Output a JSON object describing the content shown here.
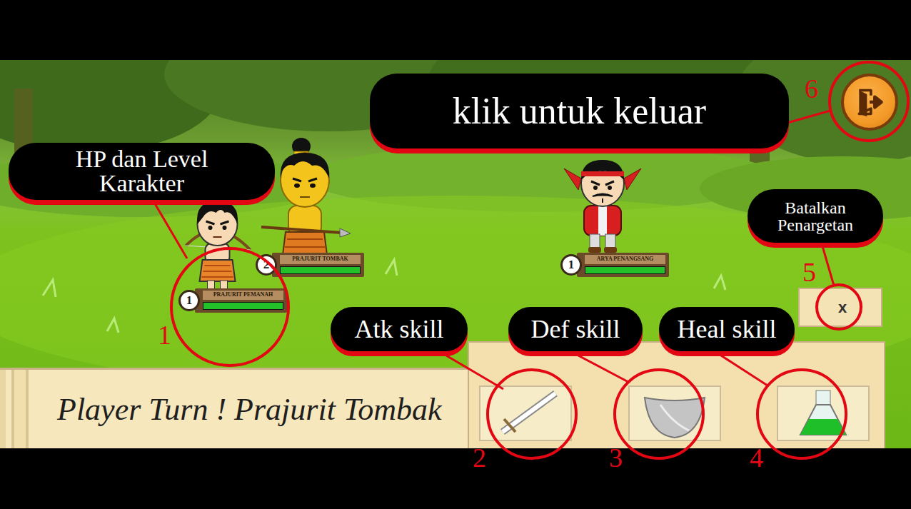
{
  "characters": [
    {
      "name": "PRAJURIT TOMBAK",
      "level": "2",
      "hp": 1,
      "kind": "spearman"
    },
    {
      "name": "PRAJURIT PEMANAH",
      "level": "1",
      "hp": 1,
      "kind": "archer"
    },
    {
      "name": "ARYA PENANGSANG",
      "level": "1",
      "hp": 1,
      "kind": "enemy"
    }
  ],
  "turn_text": "Player Turn ! Prajurit Tombak",
  "skills": [
    {
      "kind": "attack"
    },
    {
      "kind": "defense"
    },
    {
      "kind": "heal"
    }
  ],
  "cancel_label": "x",
  "annotations": [
    {
      "number": "1",
      "label": "HP dan Level Karakter"
    },
    {
      "number": "2",
      "label": "Atk skill"
    },
    {
      "number": "3",
      "label": "Def skill"
    },
    {
      "number": "4",
      "label": "Heal skill"
    },
    {
      "number": "5",
      "label": "Batalkan Penargetan"
    },
    {
      "number": "6",
      "label": "klik untuk keluar"
    }
  ]
}
